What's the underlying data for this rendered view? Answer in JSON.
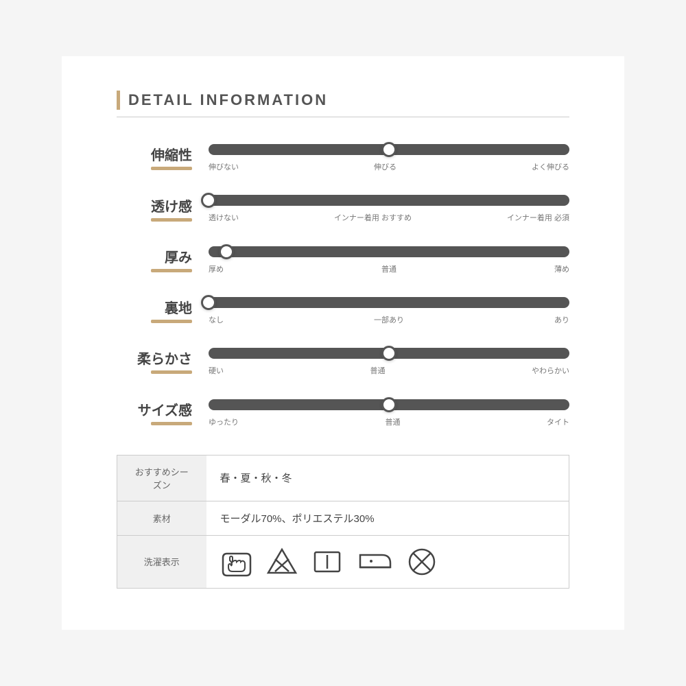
{
  "header": {
    "bar_color": "#c8a97a",
    "title": "DETAIL INFORMATION"
  },
  "sliders": [
    {
      "id": "stretch",
      "label": "伸縮性",
      "thumb_percent": 50,
      "labels": [
        "伸びない",
        "伸びる",
        "よく伸びる"
      ]
    },
    {
      "id": "transparency",
      "label": "透け感",
      "thumb_percent": 0,
      "labels": [
        "透けない",
        "インナー着用\nおすすめ",
        "インナー着用\n必須"
      ]
    },
    {
      "id": "thickness",
      "label": "厚み",
      "thumb_percent": 5,
      "labels": [
        "厚め",
        "普通",
        "薄め"
      ]
    },
    {
      "id": "lining",
      "label": "裏地",
      "thumb_percent": 0,
      "labels": [
        "なし",
        "一部あり",
        "あり"
      ]
    },
    {
      "id": "softness",
      "label": "柔らかさ",
      "thumb_percent": 50,
      "labels": [
        "硬い",
        "普通",
        "やわらかい"
      ]
    },
    {
      "id": "size",
      "label": "サイズ感",
      "thumb_percent": 50,
      "labels": [
        "ゆったり",
        "普通",
        "タイト"
      ]
    }
  ],
  "info_table": {
    "rows": [
      {
        "label": "おすすめシーズン",
        "value": "春・夏・秋・冬"
      },
      {
        "label": "素材",
        "value": "モーダル70%、ポリエステル30%"
      },
      {
        "label": "洗濯表示",
        "value": "icons"
      }
    ]
  }
}
